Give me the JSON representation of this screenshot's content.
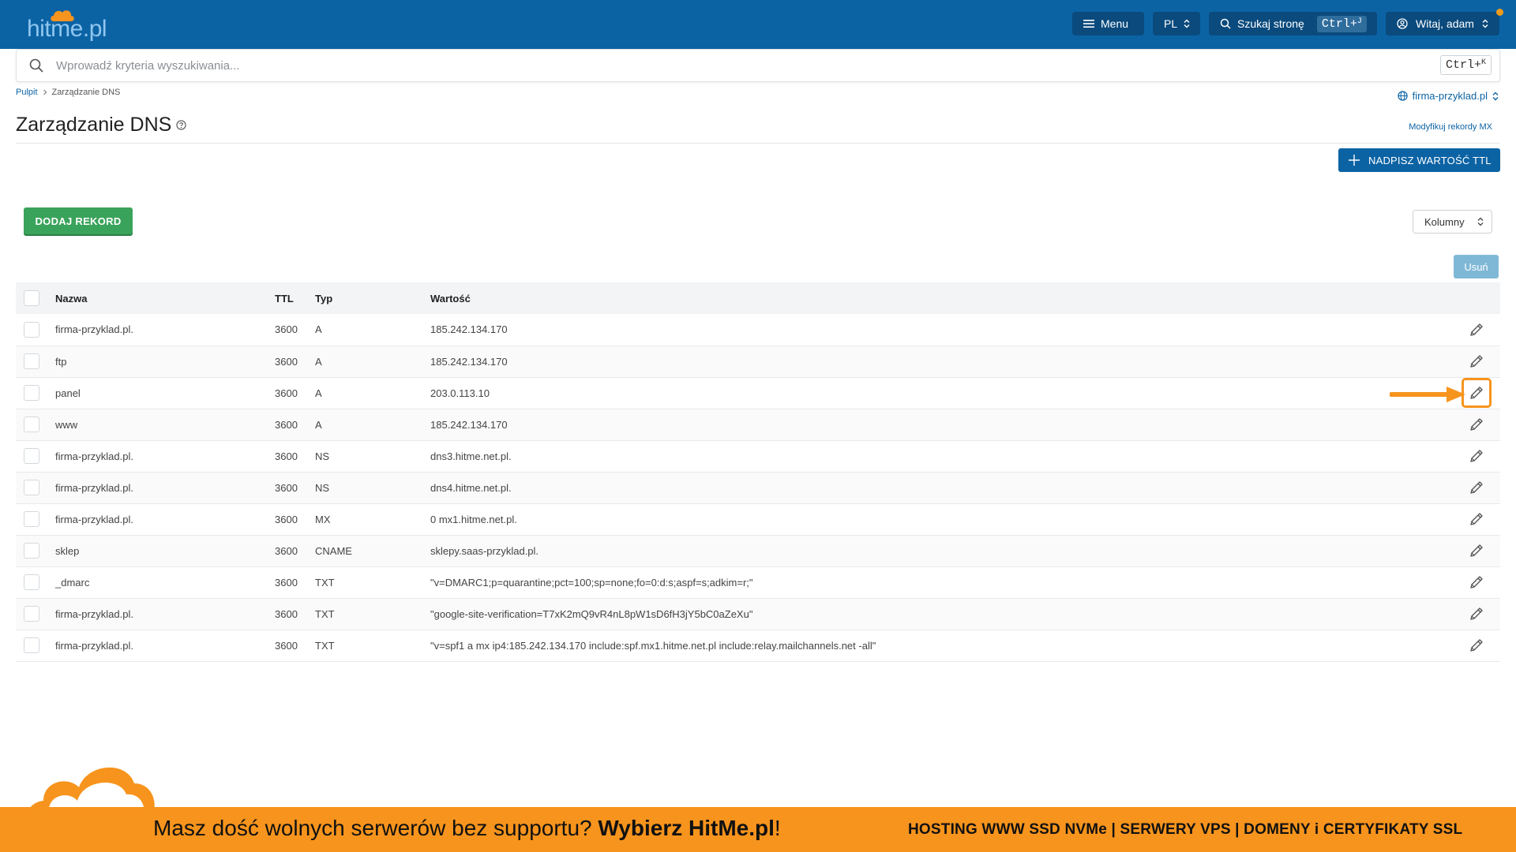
{
  "header": {
    "logo_text": "hitme.pl",
    "menu_label": "Menu",
    "lang_label": "PL",
    "search_page_label": "Szukaj stronę",
    "search_shortcut_key": "Ctrl+",
    "search_shortcut_letter": "J",
    "user_greeting": "Witaj, adam",
    "notification_color": "#f09a1a"
  },
  "search": {
    "placeholder": "Wprowadź kryteria wyszukiwania...",
    "shortcut_key": "Ctrl+",
    "shortcut_letter": "K"
  },
  "breadcrumb": {
    "home": "Pulpit",
    "separator": ">",
    "current": "Zarządzanie DNS"
  },
  "domain_selector": {
    "value": "firma-przyklad.pl"
  },
  "page": {
    "title": "Zarządzanie DNS",
    "mx_link": "Modyfikuj rekordy MX",
    "override_ttl_button": "NADPISZ WARTOŚĆ TTL",
    "add_record_button": "DODAJ REKORD",
    "columns_button": "Kolumny",
    "delete_button": "Usuń"
  },
  "table": {
    "headers": {
      "name": "Nazwa",
      "ttl": "TTL",
      "type": "Typ",
      "value": "Wartość"
    },
    "rows": [
      {
        "name": "firma-przyklad.pl.",
        "ttl": "3600",
        "type": "A",
        "value": "185.242.134.170"
      },
      {
        "name": "ftp",
        "ttl": "3600",
        "type": "A",
        "value": "185.242.134.170"
      },
      {
        "name": "panel",
        "ttl": "3600",
        "type": "A",
        "value": "203.0.113.10"
      },
      {
        "name": "www",
        "ttl": "3600",
        "type": "A",
        "value": "185.242.134.170"
      },
      {
        "name": "firma-przyklad.pl.",
        "ttl": "3600",
        "type": "NS",
        "value": "dns3.hitme.net.pl."
      },
      {
        "name": "firma-przyklad.pl.",
        "ttl": "3600",
        "type": "NS",
        "value": "dns4.hitme.net.pl."
      },
      {
        "name": "firma-przyklad.pl.",
        "ttl": "3600",
        "type": "MX",
        "value": "0 mx1.hitme.net.pl."
      },
      {
        "name": "sklep",
        "ttl": "3600",
        "type": "CNAME",
        "value": "sklepy.saas-przyklad.pl."
      },
      {
        "name": "_dmarc",
        "ttl": "3600",
        "type": "TXT",
        "value": "\"v=DMARC1;p=quarantine;pct=100;sp=none;fo=0:d:s;aspf=s;adkim=r;\""
      },
      {
        "name": "firma-przyklad.pl.",
        "ttl": "3600",
        "type": "TXT",
        "value": "\"google-site-verification=T7xK2mQ9vR4nL8pW1sD6fH3jY5bC0aZeXu\""
      },
      {
        "name": "firma-przyklad.pl.",
        "ttl": "3600",
        "type": "TXT",
        "value": "\"v=spf1 a mx ip4:185.242.134.170 include:spf.mx1.hitme.net.pl include:relay.mailchannels.net -all\""
      }
    ],
    "highlighted_row": 2
  },
  "banner": {
    "text_regular": "Masz dość wolnych serwerów bez supportu? ",
    "text_bold": "Wybierz HitMe.pl",
    "text_end": "!",
    "right_text": "HOSTING WWW SSD NVMe | SERWERY VPS | DOMENY i CERTYFIKATY SSL"
  },
  "colors": {
    "header_bg": "#0c63a4",
    "add_button": "#3aa35b",
    "accent_orange": "#f7941d"
  }
}
